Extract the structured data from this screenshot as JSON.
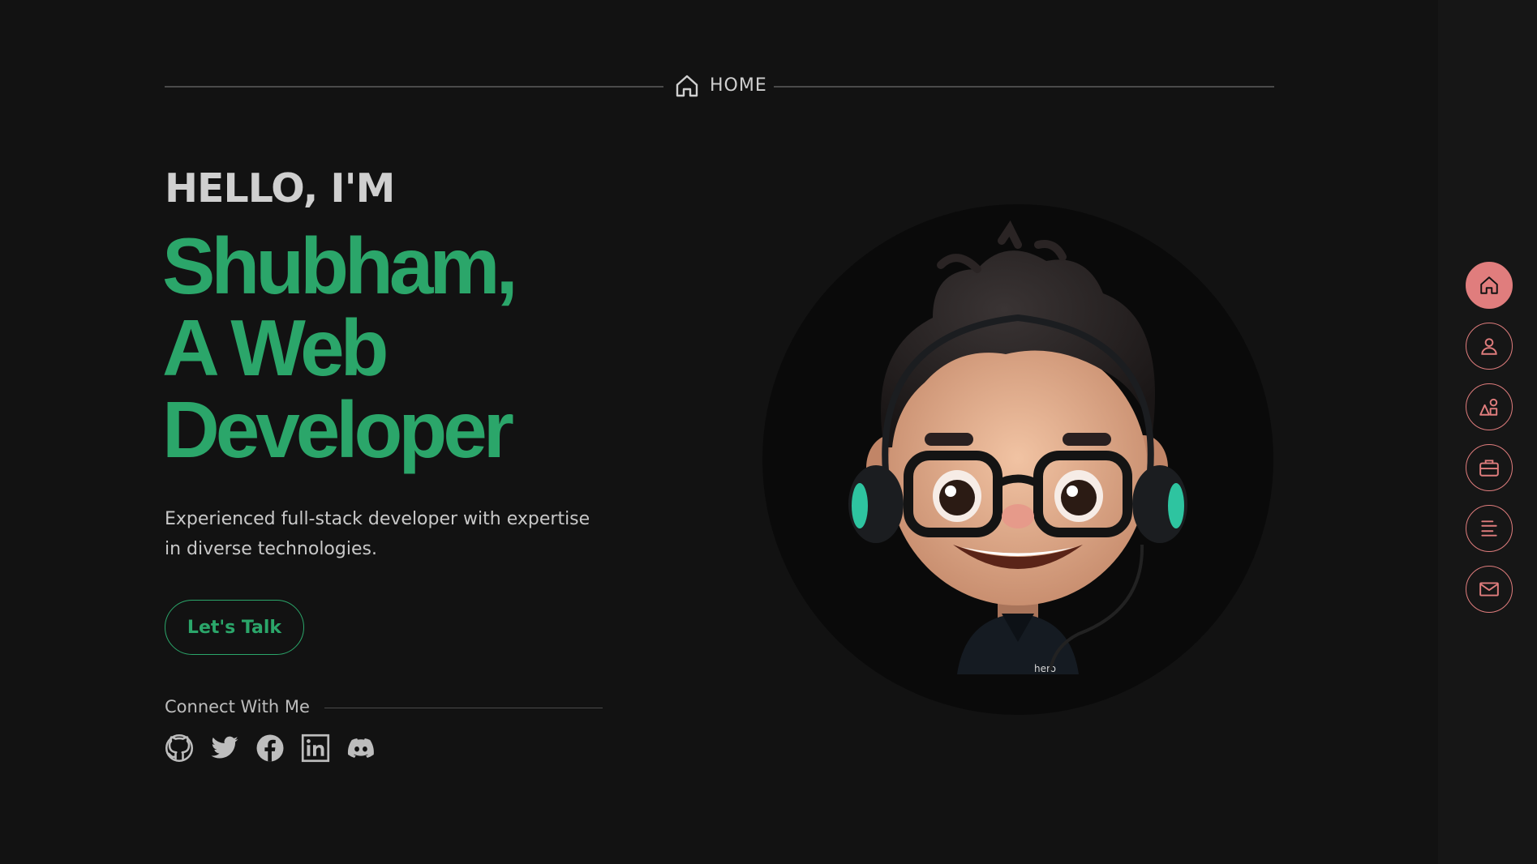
{
  "section": {
    "title": "HOME",
    "icon": "home-icon"
  },
  "hero": {
    "greeting": "HELLO, I'M",
    "headline_lines": [
      "Shubham,",
      "A Web",
      "Developer"
    ],
    "bio_lines": [
      "Experienced full-stack developer with expertise",
      "in diverse technologies."
    ],
    "cta_label": "Let's Talk"
  },
  "connect": {
    "label": "Connect With Me",
    "socials": [
      {
        "name": "github",
        "icon": "github-icon"
      },
      {
        "name": "twitter",
        "icon": "twitter-icon"
      },
      {
        "name": "facebook",
        "icon": "facebook-icon"
      },
      {
        "name": "linkedin",
        "icon": "linkedin-icon"
      },
      {
        "name": "discord",
        "icon": "discord-icon"
      }
    ]
  },
  "avatar": {
    "icon": "avatar-illustration",
    "shirt_text": "hero"
  },
  "nav": {
    "items": [
      {
        "name": "home",
        "icon": "home-icon",
        "active": true
      },
      {
        "name": "about",
        "icon": "user-icon",
        "active": false
      },
      {
        "name": "skills",
        "icon": "shapes-icon",
        "active": false
      },
      {
        "name": "portfolio",
        "icon": "briefcase-icon",
        "active": false
      },
      {
        "name": "timeline",
        "icon": "align-icon",
        "active": false
      },
      {
        "name": "contact",
        "icon": "mail-icon",
        "active": false
      }
    ]
  },
  "colors": {
    "background": "#121212",
    "accent_green": "#2ba66a",
    "accent_pink": "#e07d7d",
    "text": "#cfcfcf"
  }
}
